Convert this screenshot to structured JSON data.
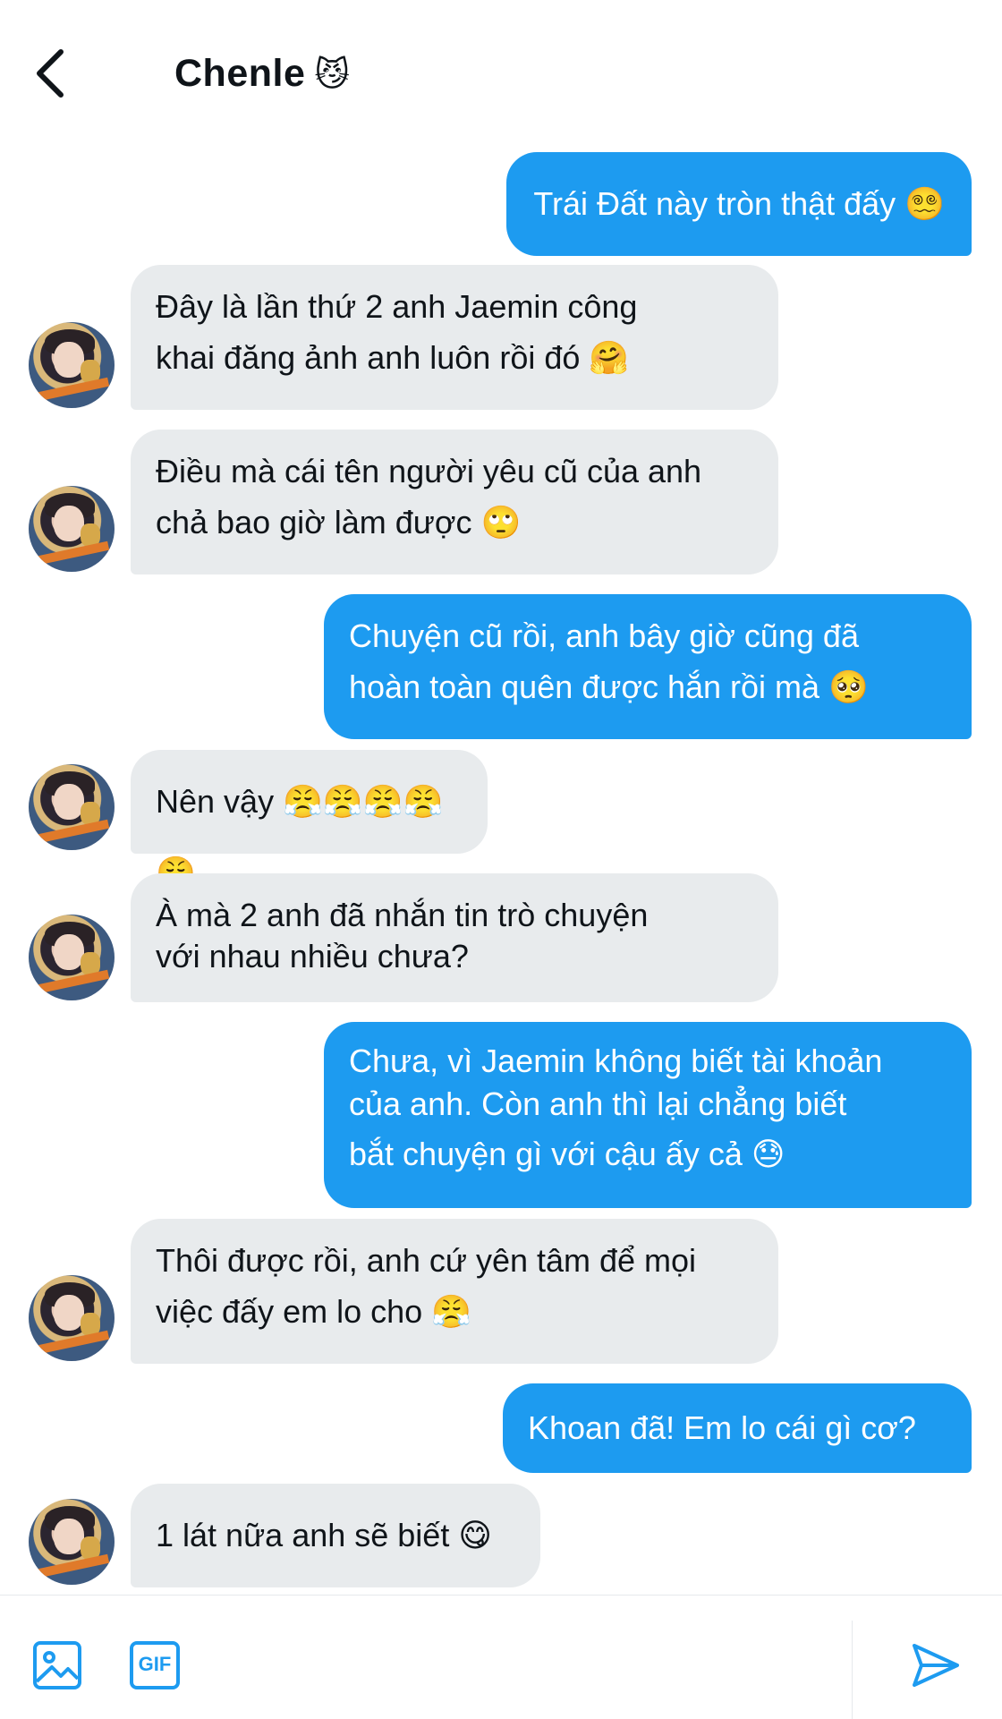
{
  "header": {
    "contact_name": "Chenle",
    "name_emoji": "😼"
  },
  "messages": [
    {
      "side": "out",
      "text": "Trái Đất này tròn thật đấy 😵‍💫"
    },
    {
      "side": "in",
      "lines": [
        "Đây là lần thứ 2 anh Jaemin công",
        "khai đăng ảnh anh luôn rồi đó 🤗"
      ]
    },
    {
      "side": "in",
      "lines": [
        "Điều mà cái tên người yêu cũ của anh",
        "chả bao giờ làm được 🙄"
      ]
    },
    {
      "side": "out",
      "lines": [
        "Chuyện cũ rồi, anh bây giờ cũng đã",
        "hoàn toàn quên được hắn rồi mà 🥺"
      ]
    },
    {
      "side": "in",
      "text": "Nên vậy 😤😤😤😤😤"
    },
    {
      "side": "in",
      "lines": [
        "À mà 2 anh đã nhắn tin trò chuyện",
        "với nhau nhiều chưa?"
      ]
    },
    {
      "side": "out",
      "lines": [
        "Chưa, vì Jaemin không biết tài khoản",
        "của anh. Còn anh thì lại chẳng biết",
        "bắt chuyện gì với cậu ấy cả 😓"
      ]
    },
    {
      "side": "in",
      "lines": [
        "Thôi được rồi, anh cứ yên tâm để mọi",
        "việc đấy em lo cho 😤"
      ]
    },
    {
      "side": "out",
      "text": "Khoan đã! Em lo cái gì cơ?"
    },
    {
      "side": "in",
      "text": "1 lát nữa anh sẽ biết 😋"
    }
  ],
  "composer": {
    "image_icon": "image-icon",
    "gif_label": "GIF",
    "send_icon": "send-icon"
  },
  "colors": {
    "accent": "#1d9bf0",
    "incoming_bubble": "#e8ebed"
  }
}
